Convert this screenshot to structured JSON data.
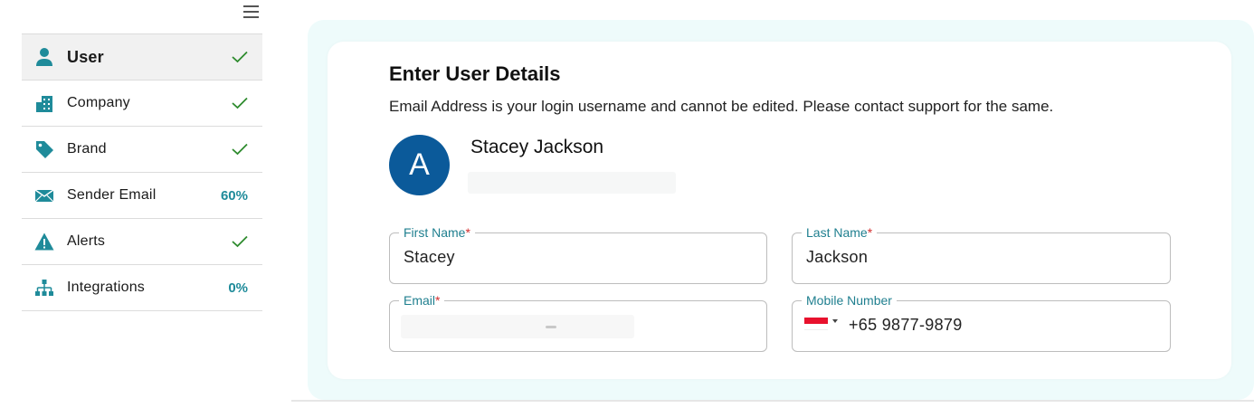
{
  "sidebar": {
    "items": [
      {
        "label": "User",
        "status": "check",
        "icon": "user-icon"
      },
      {
        "label": "Company",
        "status": "check",
        "icon": "building-icon"
      },
      {
        "label": "Brand",
        "status": "check",
        "icon": "tag-icon"
      },
      {
        "label": "Sender Email",
        "status": "60%",
        "icon": "envelope-icon"
      },
      {
        "label": "Alerts",
        "status": "check",
        "icon": "warning-icon"
      },
      {
        "label": "Integrations",
        "status": "0%",
        "icon": "hierarchy-icon"
      }
    ]
  },
  "colors": {
    "accent": "#1f8b9a",
    "check": "#2e8b2e",
    "avatar_bg": "#0b5a9a",
    "panel_bg": "#eefbfb",
    "required": "#d32f2f"
  },
  "form": {
    "title": "Enter User Details",
    "description": "Email Address is your login username and cannot be edited. Please contact support for the same.",
    "avatar_initial": "A",
    "user_name": "Stacey Jackson",
    "first_name": {
      "label": "First Name",
      "required_mark": "*",
      "value": "Stacey"
    },
    "last_name": {
      "label": "Last Name",
      "required_mark": "*",
      "value": "Jackson"
    },
    "email": {
      "label": "Email",
      "required_mark": "*"
    },
    "mobile": {
      "label": "Mobile Number",
      "country_flag": "singapore-flag-icon",
      "value": "+65 9877-9879"
    }
  }
}
